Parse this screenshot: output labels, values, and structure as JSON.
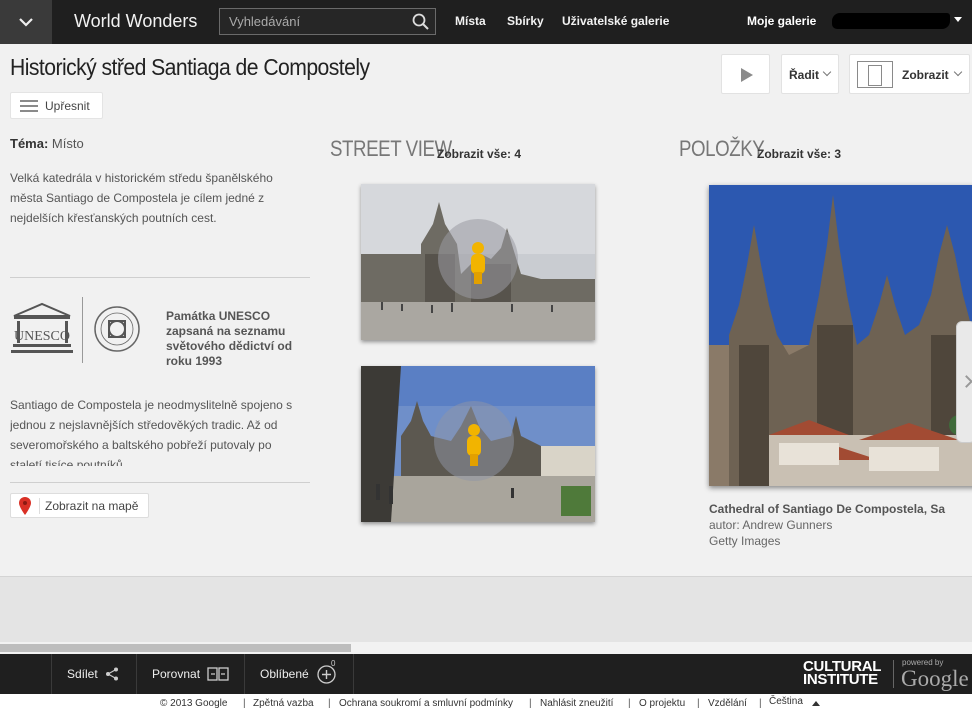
{
  "topbar": {
    "brand": "World Wonders",
    "search_placeholder": "Vyhledávání",
    "nav": [
      "Místa",
      "Sbírky",
      "Uživatelské galerie"
    ],
    "my_gallery": "Moje galerie"
  },
  "page": {
    "title": "Historický střed Santiaga de Compostely",
    "refine_label": "Upřesnit"
  },
  "toolbar": {
    "sort_label": "Řadit",
    "view_label": "Zobrazit"
  },
  "info": {
    "theme_key": "Téma:",
    "theme_value": "Místo",
    "description": "Velká katedrála v historickém středu španělského města Santiago de Compostela je cílem jedné z nejdelších křesťanských poutních cest.",
    "unesco_logo_text": "UNESCO",
    "unesco_text": "Památka UNESCO zapsaná na seznamu světového dědictví od roku 1993",
    "long_description": "Santiago de Compostela je neodmyslitelně spojeno s jednou z nejslavnějších středověkých tradic. Až od severomořského a baltského pobřeží putovaly po staletí tisíce poutníků",
    "map_button": "Zobrazit na mapě"
  },
  "street_view": {
    "heading": "STREET VIEW",
    "see_all": "Zobrazit vše: 4"
  },
  "items": {
    "heading": "POLOŽKY",
    "see_all": "Zobrazit vše: 3",
    "first": {
      "title": "Cathedral of Santiago De Compostela, Sa",
      "author": "autor: Andrew Gunners",
      "source": "Getty Images"
    }
  },
  "bottombar": {
    "share": "Sdílet",
    "compare": "Porovnat",
    "favorites": "Oblíbené",
    "favorites_count": "0",
    "ci_line1": "CULTURAL",
    "ci_line2": "INSTITUTE",
    "powered_by": "powered by",
    "google": "Google"
  },
  "footer": {
    "copyright": "© 2013 Google",
    "links": [
      "Zpětná vazba",
      "Ochrana soukromí a smluvní podmínky",
      "Nahlásit zneužití",
      "O projektu",
      "Vzdělání",
      "Čeština"
    ]
  },
  "colors": {
    "topbar_bg": "#1f1f1f",
    "page_bg": "#f1f1f1",
    "pegman": "#f2b400",
    "map_pin": "#d93025"
  }
}
